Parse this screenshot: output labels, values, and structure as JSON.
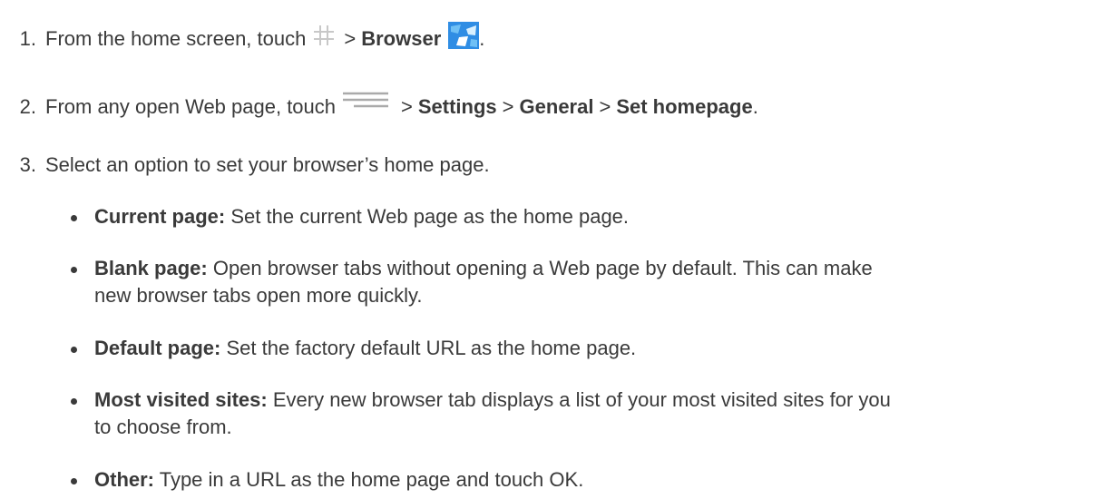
{
  "steps": [
    {
      "number": "1.",
      "parts": {
        "pre": "From the home screen, touch",
        "sep1": ">",
        "b1": "Browser",
        "end": "."
      },
      "icons": [
        "apps-grid-icon",
        "browser-icon"
      ]
    },
    {
      "number": "2.",
      "parts": {
        "pre": "From any open Web page, touch",
        "sep1": ">",
        "b1": "Settings",
        "sep2": ">",
        "b2": "General",
        "sep3": ">",
        "b3": "Set homepage",
        "end": "."
      },
      "icons": [
        "menu-icon"
      ]
    },
    {
      "number": "3.",
      "text": "Select an option to set your browser’s home page."
    }
  ],
  "options": [
    {
      "label": "Current page:",
      "desc": "Set the current Web page as the home page."
    },
    {
      "label": "Blank page:",
      "desc": "Open browser tabs without opening a Web page by default. This can make",
      "desc2": "new browser tabs open more quickly."
    },
    {
      "label": "Default page:",
      "desc": "Set the factory default URL as the home page."
    },
    {
      "label": "Most visited sites:",
      "desc": "Every new browser tab displays a list of your most visited sites for you",
      "desc2": "to choose from."
    },
    {
      "label": "Other:",
      "desc": "Type in a URL as the home page and touch OK."
    }
  ],
  "colors": {
    "text": "#3a3a3a",
    "grid_icon": "#c8c8c8",
    "menu_icon": "#aaaaaa",
    "browser_icon_blue": "#2f8de4",
    "browser_icon_light": "#6fc0f5"
  }
}
